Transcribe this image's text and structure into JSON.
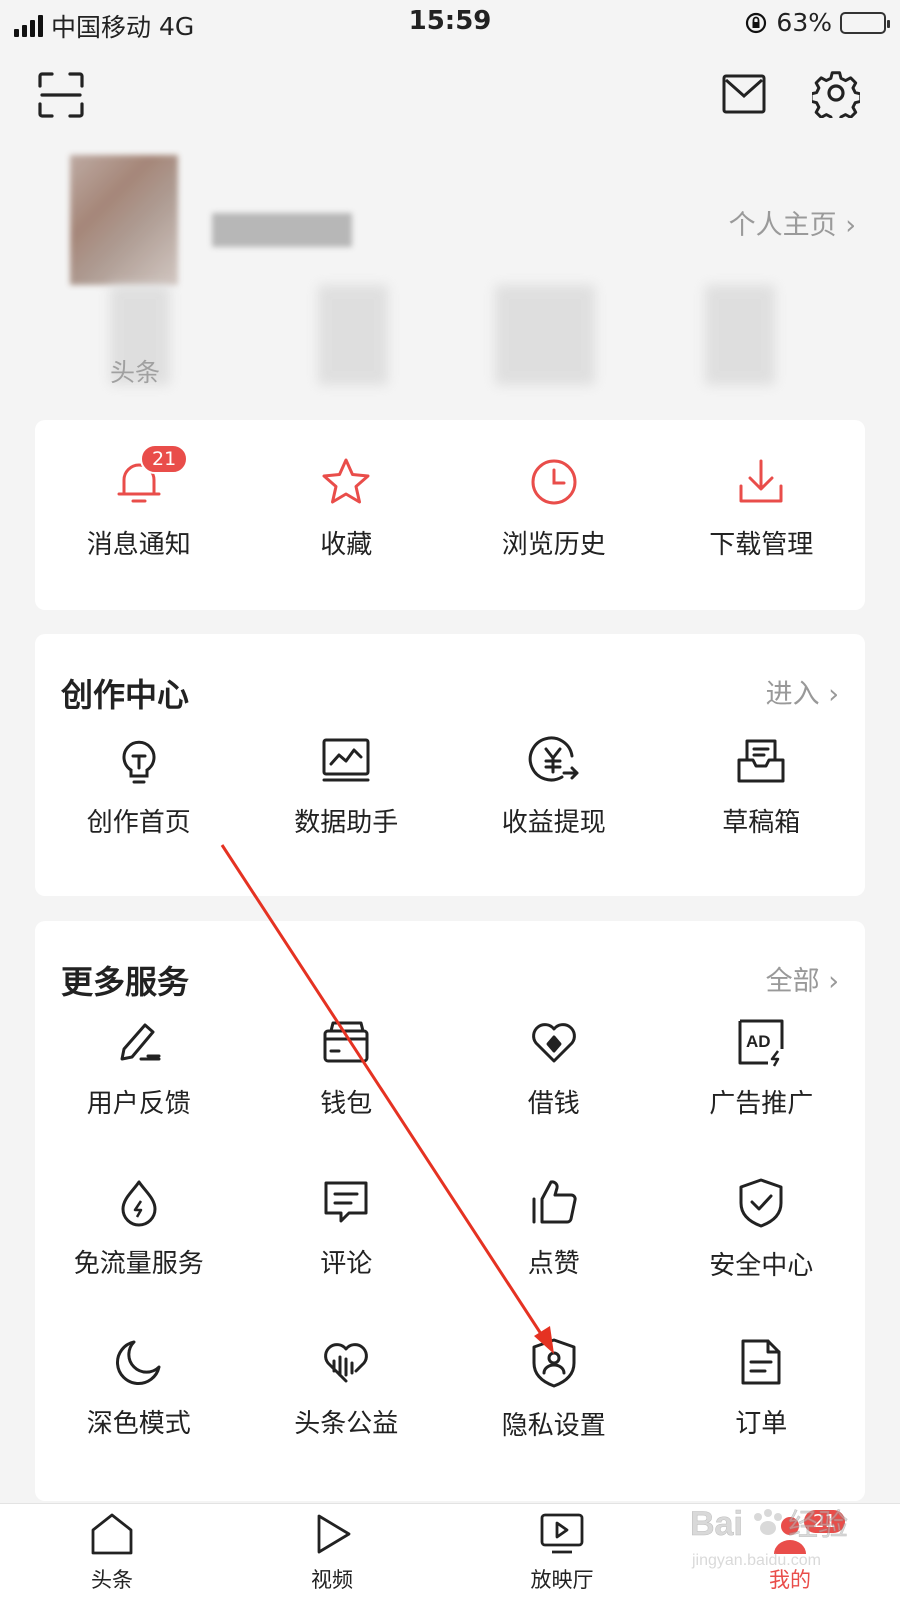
{
  "status": {
    "carrier": "中国移动",
    "network": "4G",
    "time": "15:59",
    "battery": "63%",
    "battery_level": 0.63
  },
  "profile": {
    "homepage_link": "个人主页",
    "stat_label_1": "头条"
  },
  "quick": [
    {
      "label": "消息通知",
      "icon": "bell-icon",
      "badge": "21"
    },
    {
      "label": "收藏",
      "icon": "star-icon"
    },
    {
      "label": "浏览历史",
      "icon": "clock-icon"
    },
    {
      "label": "下载管理",
      "icon": "download-icon"
    }
  ],
  "creation": {
    "title": "创作中心",
    "link": "进入",
    "items": [
      {
        "label": "创作首页",
        "icon": "lightbulb-icon"
      },
      {
        "label": "数据助手",
        "icon": "chart-monitor-icon"
      },
      {
        "label": "收益提现",
        "icon": "yuan-withdraw-icon"
      },
      {
        "label": "草稿箱",
        "icon": "draft-box-icon"
      }
    ]
  },
  "services": {
    "title": "更多服务",
    "link": "全部",
    "items": [
      {
        "label": "用户反馈",
        "icon": "pen-feedback-icon"
      },
      {
        "label": "钱包",
        "icon": "wallet-icon"
      },
      {
        "label": "借钱",
        "icon": "loan-icon"
      },
      {
        "label": "广告推广",
        "icon": "ad-icon"
      },
      {
        "label": "免流量服务",
        "icon": "drop-flow-icon"
      },
      {
        "label": "评论",
        "icon": "comment-icon"
      },
      {
        "label": "点赞",
        "icon": "thumb-up-icon"
      },
      {
        "label": "安全中心",
        "icon": "shield-check-icon"
      },
      {
        "label": "深色模式",
        "icon": "moon-icon"
      },
      {
        "label": "头条公益",
        "icon": "charity-heart-icon"
      },
      {
        "label": "隐私设置",
        "icon": "privacy-shield-icon"
      },
      {
        "label": "订单",
        "icon": "order-doc-icon"
      }
    ]
  },
  "tabbar": [
    {
      "label": "头条",
      "icon": "home-icon"
    },
    {
      "label": "视频",
      "icon": "play-icon"
    },
    {
      "label": "放映厅",
      "icon": "screen-play-icon"
    },
    {
      "label": "我的",
      "icon": "profile-icon",
      "badge": "21",
      "active": true
    }
  ],
  "colors": {
    "accent": "#e94d4a",
    "icon_stroke": "#222222",
    "muted": "#999999"
  },
  "watermark": {
    "text_1": "Bai",
    "text_2": "经验",
    "text_3": "jingyan.baidu.com"
  }
}
